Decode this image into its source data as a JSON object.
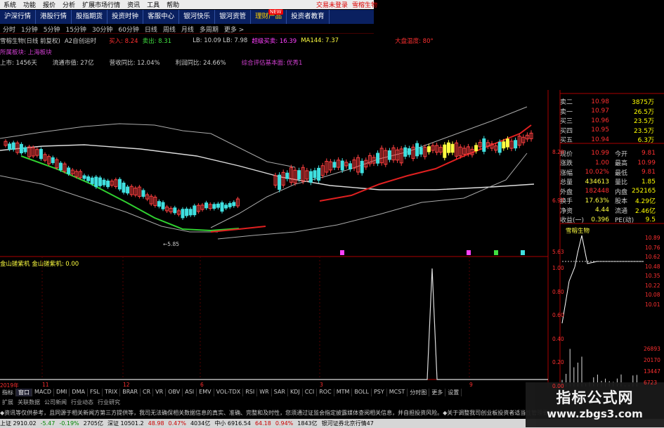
{
  "menu": {
    "items": [
      "系统",
      "功能",
      "报价",
      "分析",
      "扩展市场行情",
      "资讯",
      "工具",
      "帮助"
    ],
    "right": [
      "交易未登录",
      "雪榕生物"
    ]
  },
  "toolbar": {
    "items": [
      "沪深行情",
      "港股行情",
      "股指期货",
      "投资时钟",
      "客服中心",
      "银河快乐",
      "银河资管",
      "理财产品",
      "投资者教育"
    ],
    "new_badge": "NEW"
  },
  "periods": [
    "分时",
    "1分钟",
    "5分钟",
    "15分钟",
    "30分钟",
    "60分钟",
    "日线",
    "周线",
    "月线",
    "多周期",
    "更多 >"
  ],
  "info": {
    "stock": "雪榕生物(日线 前复权)",
    "indicator": "A2自创运时",
    "buy": "买入: 8.24",
    "sell": "卖出: 8.31",
    "ma": "MA144: 7.37",
    "lb": "LB: 10.09 LB: 7.98",
    "magenta": "超级买卖: 16.39",
    "market": "大盘温度: 80°"
  },
  "board_line": "所属板块: 上海板块",
  "stats": {
    "listed": "上市: 1456天",
    "circ_cap": "流通市值: 27亿",
    "revenue": "营收同比: 12.04%",
    "profit": "利润同比: 24.66%",
    "score_label": "综合评估基本面:",
    "score_val": "优秀1"
  },
  "quote": {
    "asks": [
      {
        "label": "卖二",
        "price": "10.98",
        "vol": "3875万"
      },
      {
        "label": "卖一",
        "price": "10.97",
        "vol": "26.5万"
      },
      {
        "label": "买三",
        "price": "10.96",
        "vol": "23.5万"
      },
      {
        "label": "买四",
        "price": "10.95",
        "vol": "23.5万"
      },
      {
        "label": "买五",
        "price": "10.94",
        "vol": "6.3万"
      }
    ],
    "rows": [
      {
        "l1": "现价",
        "v1": "10.99",
        "l2": "今开",
        "v2": "9.81"
      },
      {
        "l1": "涨跌",
        "v1": "1.00",
        "l2": "最高",
        "v2": "10.99"
      },
      {
        "l1": "涨幅",
        "v1": "10.02%",
        "l2": "最低",
        "v2": "9.81"
      },
      {
        "l1": "总量",
        "v1": "434613",
        "l2": "量比",
        "v2": "1.85"
      },
      {
        "l1": "外盘",
        "v1": "182448",
        "l2": "内盘",
        "v2": "252165"
      },
      {
        "l1": "换手",
        "v1": "17.63%",
        "l2": "股本",
        "v2": "4.29亿"
      },
      {
        "l1": "净资",
        "v1": "4.44",
        "l2": "流通",
        "v2": "2.46亿"
      },
      {
        "l1": "收益(一)",
        "v1": "0.396",
        "l2": "PE(动)",
        "v2": "9.5"
      }
    ],
    "mini_title": "雪榕生物"
  },
  "price_axis": [
    "8.29",
    "6.97",
    "5.63"
  ],
  "mini_axis": [
    "10.89",
    "10.76",
    "10.62",
    "10.48",
    "10.35",
    "10.22",
    "10.08",
    "10.01"
  ],
  "ind_axis": [
    "1.00",
    "0.80",
    "0.60",
    "0.40",
    "0.20",
    "0.00"
  ],
  "vol_axis": [
    "26893",
    "20170",
    "13447",
    "6723"
  ],
  "indicator_label": "金山搓紫机 金山搓紫机: 0.00",
  "low_label": "←5.85",
  "date_labels": [
    "2019年",
    "11",
    "12",
    "6",
    "3",
    "9"
  ],
  "tabs": [
    "指标",
    "窗口",
    "MACD",
    "DMI",
    "DMA",
    "FSL",
    "TRIX",
    "BRAR",
    "CR",
    "VR",
    "OBV",
    "ASI",
    "EMV",
    "VOL-TDX",
    "RSI",
    "WR",
    "SAR",
    "KDJ",
    "CCI",
    "ROC",
    "MTM",
    "BOLL",
    "PSY",
    "MCST",
    "分时图",
    "更多",
    "设置"
  ],
  "tabs2": [
    "扩展",
    "关联数据",
    "公司新闻",
    "行业动态",
    "行业研究"
  ],
  "news": "◆资讯等仅供参考，且同源于相关新闻方第三方提供等，我司无法确保相关数据信息的真实、准确、完整和及时性，您须通过证监会指定披露媒体查阅相关信息，并自担投资风险。◆关于调整我司创业板投资者适当性管理要求",
  "status": [
    "上证 2910.02",
    "-5.47",
    "-0.19%",
    "2705亿",
    "深证 10501.2",
    "48.98",
    "0.47%",
    "4034亿",
    "中小 6916.54",
    "64.18",
    "0.94%",
    "1843亿",
    "银河证券北京行情47"
  ],
  "watermark": {
    "line1": "指标公式网",
    "line2": "www.zbgs3.com"
  },
  "chart_data": {
    "type": "candlestick",
    "ma_colors": {
      "white": "#dddddd",
      "green": "#30d030",
      "red": "#e02020",
      "yellow": "#d8d800"
    }
  }
}
